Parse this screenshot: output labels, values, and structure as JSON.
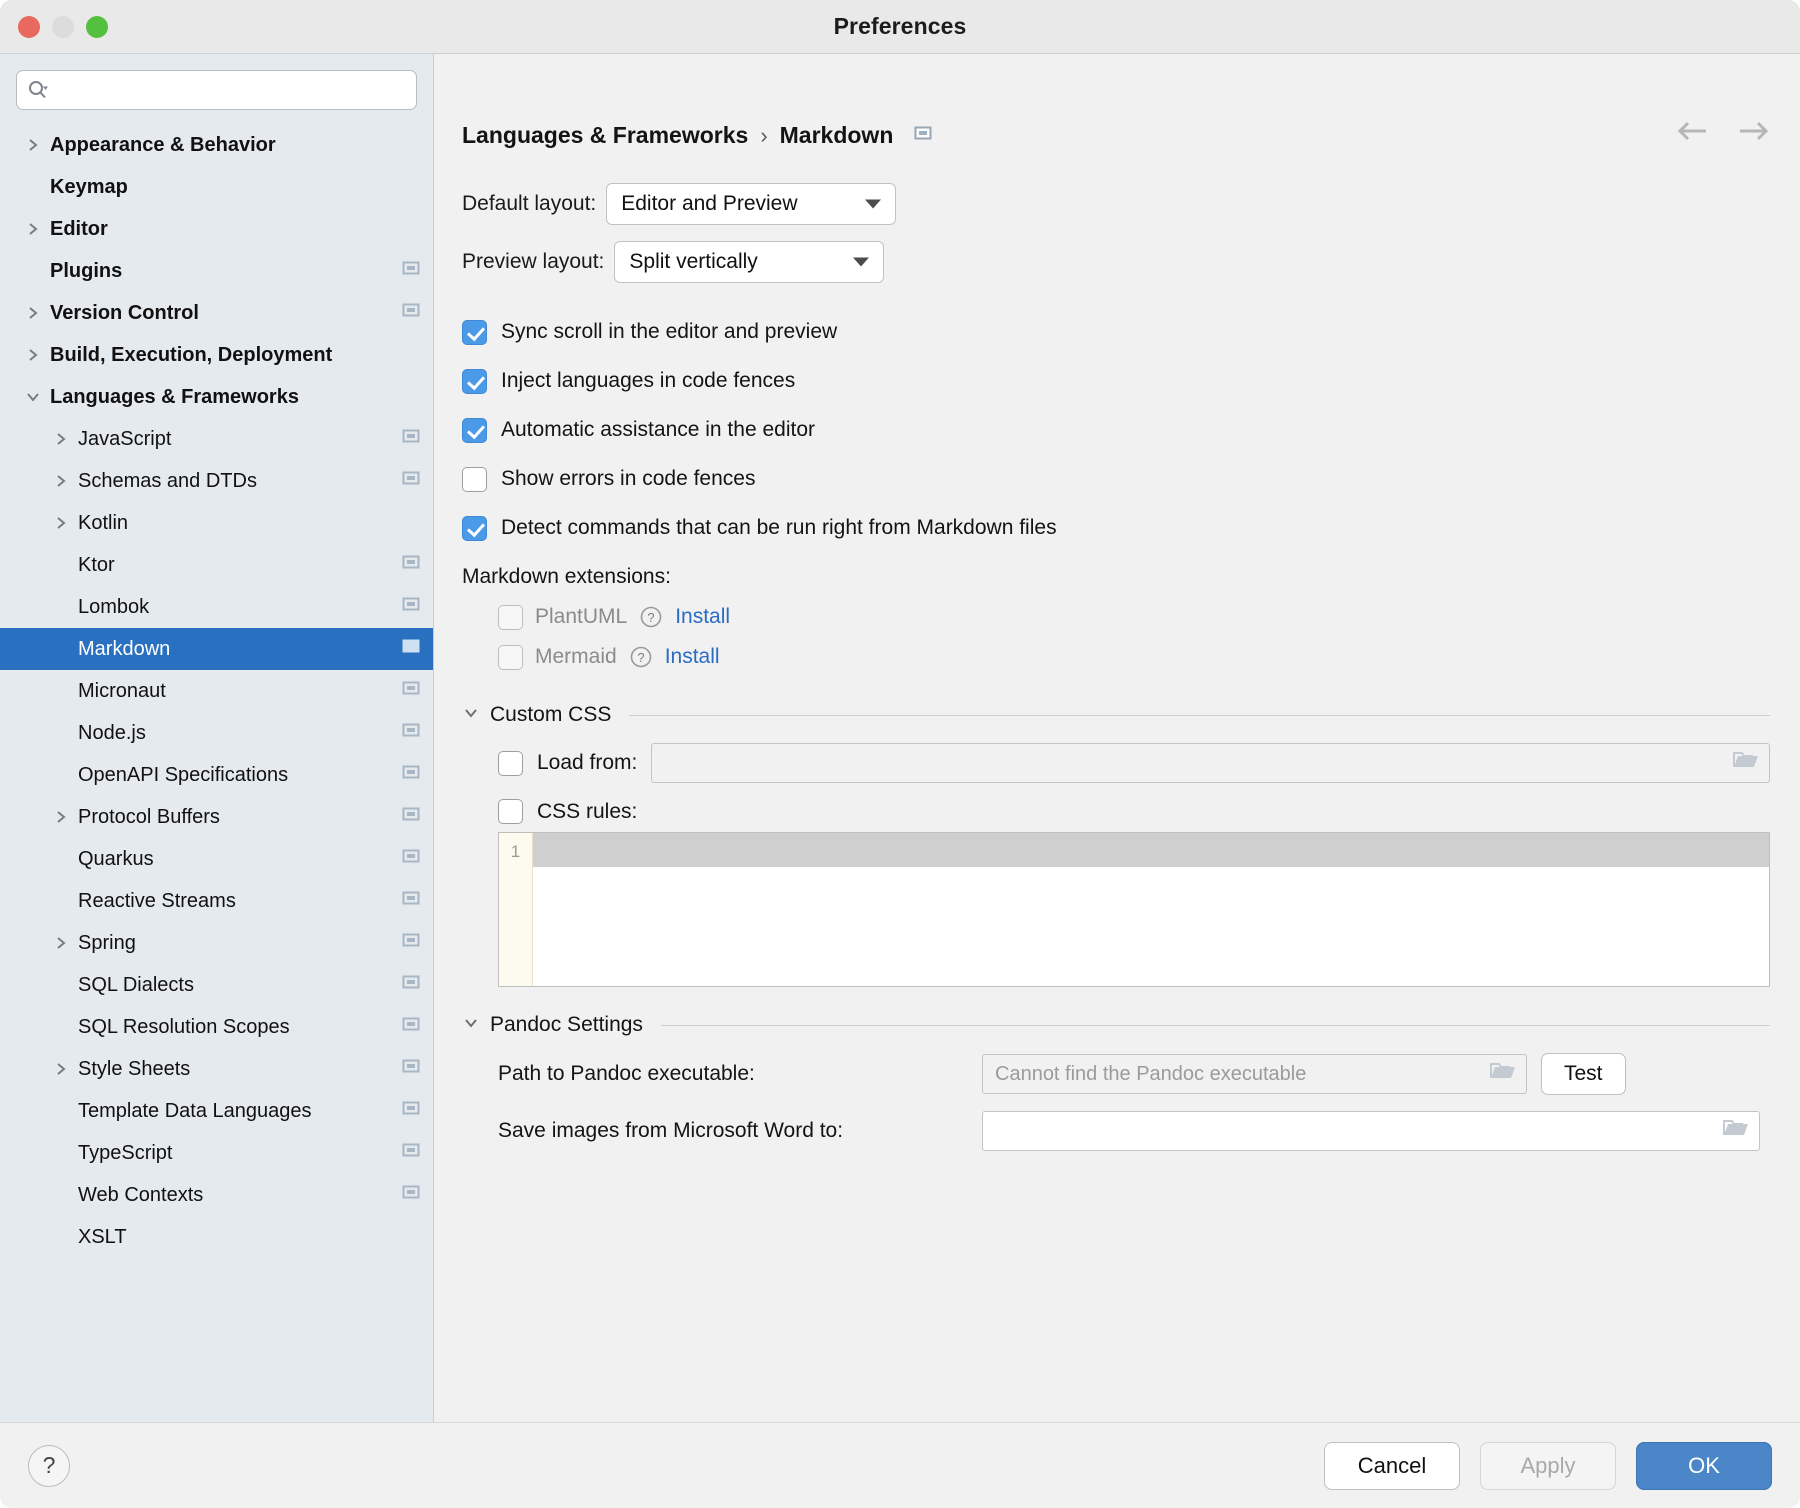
{
  "window": {
    "title": "Preferences",
    "traffic_lights": [
      "close-red",
      "minimize-yellow",
      "zoom-green"
    ]
  },
  "sidebar": {
    "search": {
      "value": "",
      "placeholder": ""
    },
    "items": [
      {
        "label": "Appearance & Behavior",
        "level": "top",
        "arrow": "right",
        "badge": false,
        "selected": false
      },
      {
        "label": "Keymap",
        "level": "top",
        "arrow": "none",
        "badge": false,
        "selected": false
      },
      {
        "label": "Editor",
        "level": "top",
        "arrow": "right",
        "badge": false,
        "selected": false
      },
      {
        "label": "Plugins",
        "level": "top",
        "arrow": "none",
        "badge": true,
        "selected": false
      },
      {
        "label": "Version Control",
        "level": "top",
        "arrow": "right",
        "badge": true,
        "selected": false
      },
      {
        "label": "Build, Execution, Deployment",
        "level": "top",
        "arrow": "right",
        "badge": false,
        "selected": false
      },
      {
        "label": "Languages & Frameworks",
        "level": "top",
        "arrow": "down",
        "badge": false,
        "selected": false
      },
      {
        "label": "JavaScript",
        "level": "child",
        "arrow": "right",
        "badge": true,
        "selected": false
      },
      {
        "label": "Schemas and DTDs",
        "level": "child",
        "arrow": "right",
        "badge": true,
        "selected": false
      },
      {
        "label": "Kotlin",
        "level": "child",
        "arrow": "right",
        "badge": false,
        "selected": false
      },
      {
        "label": "Ktor",
        "level": "child",
        "arrow": "none",
        "badge": true,
        "selected": false
      },
      {
        "label": "Lombok",
        "level": "child",
        "arrow": "none",
        "badge": true,
        "selected": false
      },
      {
        "label": "Markdown",
        "level": "child",
        "arrow": "none",
        "badge": true,
        "selected": true
      },
      {
        "label": "Micronaut",
        "level": "child",
        "arrow": "none",
        "badge": true,
        "selected": false
      },
      {
        "label": "Node.js",
        "level": "child",
        "arrow": "none",
        "badge": true,
        "selected": false
      },
      {
        "label": "OpenAPI Specifications",
        "level": "child",
        "arrow": "none",
        "badge": true,
        "selected": false
      },
      {
        "label": "Protocol Buffers",
        "level": "child",
        "arrow": "right",
        "badge": true,
        "selected": false
      },
      {
        "label": "Quarkus",
        "level": "child",
        "arrow": "none",
        "badge": true,
        "selected": false
      },
      {
        "label": "Reactive Streams",
        "level": "child",
        "arrow": "none",
        "badge": true,
        "selected": false
      },
      {
        "label": "Spring",
        "level": "child",
        "arrow": "right",
        "badge": true,
        "selected": false
      },
      {
        "label": "SQL Dialects",
        "level": "child",
        "arrow": "none",
        "badge": true,
        "selected": false
      },
      {
        "label": "SQL Resolution Scopes",
        "level": "child",
        "arrow": "none",
        "badge": true,
        "selected": false
      },
      {
        "label": "Style Sheets",
        "level": "child",
        "arrow": "right",
        "badge": true,
        "selected": false
      },
      {
        "label": "Template Data Languages",
        "level": "child",
        "arrow": "none",
        "badge": true,
        "selected": false
      },
      {
        "label": "TypeScript",
        "level": "child",
        "arrow": "none",
        "badge": true,
        "selected": false
      },
      {
        "label": "Web Contexts",
        "level": "child",
        "arrow": "none",
        "badge": true,
        "selected": false
      },
      {
        "label": "XSLT",
        "level": "child",
        "arrow": "none",
        "badge": false,
        "selected": false
      }
    ]
  },
  "content": {
    "breadcrumb": {
      "parent": "Languages & Frameworks",
      "separator": "›",
      "current": "Markdown"
    },
    "default_layout": {
      "label": "Default layout:",
      "value": "Editor and Preview"
    },
    "preview_layout": {
      "label": "Preview layout:",
      "value": "Split vertically"
    },
    "checkboxes": [
      {
        "label": "Sync scroll in the editor and preview",
        "checked": true
      },
      {
        "label": "Inject languages in code fences",
        "checked": true
      },
      {
        "label": "Automatic assistance in the editor",
        "checked": true
      },
      {
        "label": "Show errors in code fences",
        "checked": false
      },
      {
        "label": "Detect commands that can be run right from Markdown files",
        "checked": true
      }
    ],
    "extensions": {
      "caption": "Markdown extensions:",
      "items": [
        {
          "label": "PlantUML",
          "checked": false,
          "disabled": true,
          "action": "Install"
        },
        {
          "label": "Mermaid",
          "checked": false,
          "disabled": true,
          "action": "Install"
        }
      ]
    },
    "custom_css": {
      "title": "Custom CSS",
      "load_from": {
        "label": "Load from:",
        "checked": false,
        "value": ""
      },
      "css_rules": {
        "label": "CSS rules:",
        "checked": false,
        "value": "",
        "line_number": "1"
      }
    },
    "pandoc": {
      "title": "Pandoc Settings",
      "path_label": "Path to Pandoc executable:",
      "path_placeholder": "Cannot find the Pandoc executable",
      "path_value": "",
      "test_button": "Test",
      "images_label": "Save images from Microsoft Word to:",
      "images_value": ""
    }
  },
  "footer": {
    "help": "?",
    "cancel": "Cancel",
    "apply": "Apply",
    "ok": "OK"
  },
  "colors": {
    "selection_blue": "#2a70c0",
    "checkbox_blue": "#4a9ae8",
    "link_blue": "#2a6cc4",
    "primary_button": "#4a86c8",
    "sidebar_bg": "#e5eaef",
    "content_bg": "#f1f1f1"
  }
}
